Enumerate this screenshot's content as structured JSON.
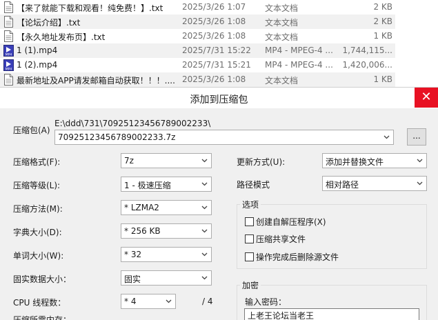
{
  "file_list": {
    "rows": [
      {
        "name": "【来了就能下载和观看！纯免费！】.txt",
        "date": "2025/3/26 1:07",
        "type": "文本文档",
        "size": "2 KB",
        "icon": "text-file-icon"
      },
      {
        "name": "【论坛介绍】.txt",
        "date": "2025/3/26 1:08",
        "type": "文本文档",
        "size": "2 KB",
        "icon": "text-file-icon"
      },
      {
        "name": "【永久地址发布页】.txt",
        "date": "2025/3/26 1:08",
        "type": "文本文档",
        "size": "1 KB",
        "icon": "text-file-icon"
      },
      {
        "name": "1 (1).mp4",
        "date": "2025/7/31 15:22",
        "type": "MP4 - MPEG-4 ...",
        "size": "1,744,115...",
        "icon": "mp4-video-icon"
      },
      {
        "name": "1 (2).mp4",
        "date": "2025/7/31 15:21",
        "type": "MP4 - MPEG-4 ...",
        "size": "1,420,006...",
        "icon": "mp4-video-icon"
      },
      {
        "name": "最新地址及APP请发邮箱自动获取！！！....",
        "date": "2025/3/26 1:08",
        "type": "文本文档",
        "size": "1 KB",
        "icon": "text-file-icon"
      }
    ]
  },
  "dialog": {
    "title": "添加到压缩包",
    "close_symbol": "✕",
    "archive": {
      "label": "压缩包(A)",
      "path": "E:\\ddd\\731\\70925123456789002233\\",
      "name": "70925123456789002233.7z",
      "browse_label": "..."
    },
    "left_options": [
      {
        "label": "压缩格式(F):",
        "value": "7z"
      },
      {
        "label": "压缩等级(L):",
        "value": "1 - 极速压缩"
      },
      {
        "label": "压缩方法(M):",
        "value": "* LZMA2"
      },
      {
        "label": "字典大小(D):",
        "value": "* 256 KB"
      },
      {
        "label": "单词大小(W):",
        "value": "* 32"
      },
      {
        "label": "固实数据大小：",
        "value": "固实"
      }
    ],
    "cpu": {
      "label": "CPU 线程数：",
      "value": "* 4",
      "max": "/ 4"
    },
    "memory_label": "压缩所需内存：",
    "update_mode": {
      "label": "更新方式(U):",
      "value": "添加并替换文件"
    },
    "path_mode": {
      "label": "路径模式",
      "value": "相对路径"
    },
    "options_group": {
      "title": "选项",
      "items": [
        {
          "label": "创建自解压程序(X)",
          "checked": false
        },
        {
          "label": "压缩共享文件",
          "checked": false
        },
        {
          "label": "操作完成后删除源文件",
          "checked": false
        }
      ]
    },
    "encryption_group": {
      "title": "加密",
      "password_label": "输入密码：",
      "password_value": "上老王论坛当老王"
    }
  },
  "colors": {
    "close_red": "#e81123",
    "dialog_bg": "#f0f0f0",
    "row_alt": "#f1f1f1"
  }
}
